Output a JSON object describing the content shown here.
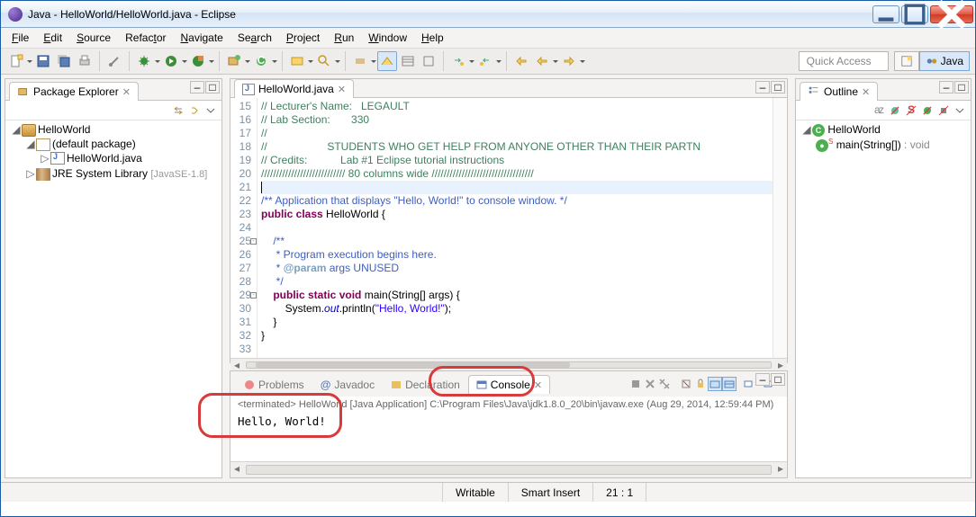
{
  "window": {
    "title": "Java - HelloWorld/HelloWorld.java - Eclipse"
  },
  "menu": [
    "File",
    "Edit",
    "Source",
    "Refactor",
    "Navigate",
    "Search",
    "Project",
    "Run",
    "Window",
    "Help"
  ],
  "quickAccess": "Quick Access",
  "perspective": "Java",
  "packageExplorer": {
    "title": "Package Explorer",
    "project": "HelloWorld",
    "defaultPkg": "(default package)",
    "file": "HelloWorld.java",
    "lib": "JRE System Library",
    "libVer": "[JavaSE-1.8]"
  },
  "editor": {
    "tab": "HelloWorld.java",
    "lines": {
      "l15": "// Lecturer's Name:   LEGAULT",
      "l16": "// Lab Section:       330",
      "l17": "//",
      "l18": "//                    STUDENTS WHO GET HELP FROM ANYONE OTHER THAN THEIR PARTN",
      "l19": "// Credits:           Lab #1 Eclipse tutorial instructions",
      "l20": "//////////////////////////// 80 columns wide //////////////////////////////////",
      "l22": "/** Application that displays \"Hello, World!\" to console window. */",
      "l23a": "public",
      "l23b": " class",
      "l23c": " HelloWorld {",
      "l25": "    /**",
      "l26": "     * Program execution begins here.",
      "l27a": "     * ",
      "l27b": "@param",
      "l27c": " args UNUSED",
      "l28": "     */",
      "l29a": "    public",
      "l29b": " static",
      "l29c": " void",
      "l29d": " main(String[] args) {",
      "l30a": "        System.",
      "l30b": "out",
      "l30c": ".println(",
      "l30d": "\"Hello, World!\"",
      "l30e": ");",
      "l31": "    }",
      "l32": "}"
    },
    "startLine": 15
  },
  "bottomTabs": {
    "problems": "Problems",
    "javadoc": "Javadoc",
    "declaration": "Declaration",
    "console": "Console"
  },
  "console": {
    "header": "<terminated> HelloWorld [Java Application] C:\\Program Files\\Java\\jdk1.8.0_20\\bin\\javaw.exe (Aug 29, 2014, 12:59:44 PM)",
    "output": "Hello, World!"
  },
  "outline": {
    "title": "Outline",
    "class": "HelloWorld",
    "method": "main(String[])",
    "ret": " : void"
  },
  "status": {
    "writable": "Writable",
    "insert": "Smart Insert",
    "pos": "21 : 1"
  }
}
